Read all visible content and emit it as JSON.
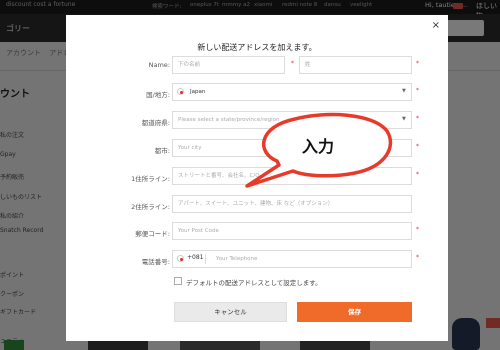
{
  "topbar": {
    "slogan": "discount cost a fortune",
    "kw_label": "検索ワード:",
    "keywords": [
      "oneplus 7t",
      "mmmy a2",
      "xiaomi",
      "redmi note 8",
      "dansu",
      "veelight"
    ],
    "user": "Hi, tautiers...",
    "wishlist": "ほしい物..."
  },
  "header": {
    "category": "ゴリー"
  },
  "breadcrumb": {
    "items": [
      "アカウント",
      "アドレ"
    ]
  },
  "sidebar": {
    "title": "ウント",
    "items": [
      "私の注文",
      "Gpay",
      "予約販売",
      "しいものリスト",
      "私の紹介",
      "Snatch Record",
      "ポイント",
      "クーポン",
      "ギフトカード",
      "ュニティ"
    ]
  },
  "modal": {
    "title": "新しい配送アドレスを加えます。",
    "close_label": "×",
    "fields": {
      "name_label": "Name:",
      "first_name_placeholder": "下の名前",
      "last_name_placeholder": "姓",
      "country_label": "国/地方:",
      "country_value": "Japan",
      "state_label": "都道府県:",
      "state_placeholder": "Please select a state/province/region",
      "city_label": "都市:",
      "city_placeholder": "Your city",
      "address1_label": "1住所ライン:",
      "address1_placeholder": "ストリートと番号、会社名、C/O",
      "address2_label": "2住所ライン:",
      "address2_placeholder": "アパート、スイート、ユニット、建物、床 など（オプション）",
      "zip_label": "郵便コード:",
      "zip_placeholder": "Your Post Code",
      "phone_label": "電話番号:",
      "phone_code": "+081",
      "phone_placeholder": "Your Telephone"
    },
    "required_mark": "*",
    "default_checkbox_label": "デフォルトの配送アドレスとして設定します。",
    "cancel_label": "キャンセル",
    "save_label": "保存"
  },
  "callout": {
    "text": "入力"
  },
  "colors": {
    "accent": "#f06b29",
    "required": "#e03030",
    "overlay": "rgba(0,0,0,0.5)"
  },
  "icons": [
    "close-icon",
    "dropdown-arrow-icon",
    "japan-flag-icon"
  ]
}
